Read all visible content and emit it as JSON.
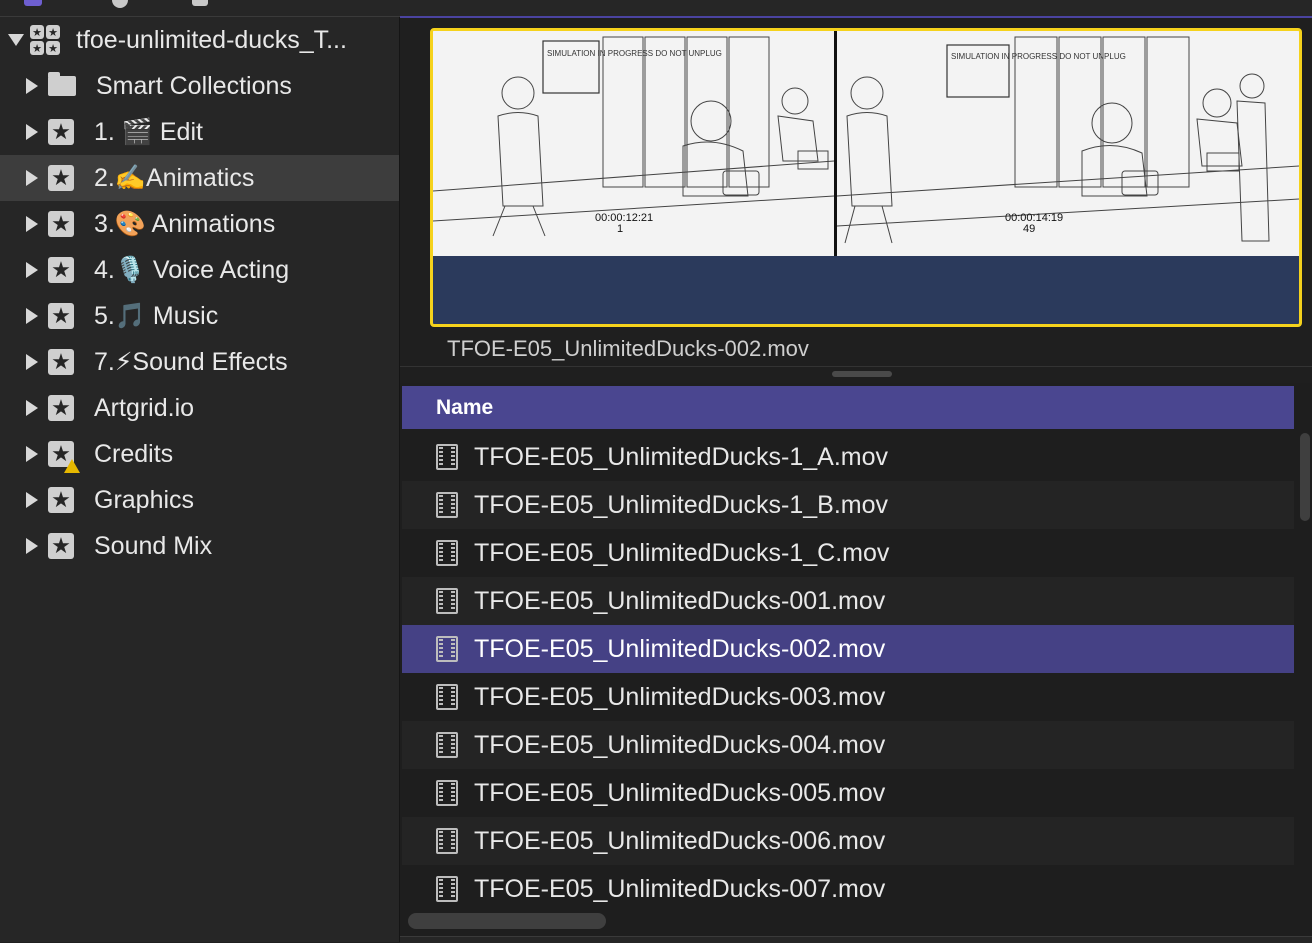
{
  "library": {
    "name": "tfoe-unlimited-ducks_T..."
  },
  "sidebar": {
    "items": [
      {
        "label": "Smart Collections",
        "icon": "folder-icon"
      },
      {
        "label": "1. 🎬 Edit",
        "icon": "star-icon"
      },
      {
        "label": "2.✍️Animatics",
        "icon": "star-icon",
        "selected": true
      },
      {
        "label": "3.🎨 Animations",
        "icon": "star-icon"
      },
      {
        "label": "4.🎙️ Voice Acting",
        "icon": "star-icon"
      },
      {
        "label": "5.🎵 Music",
        "icon": "star-icon"
      },
      {
        "label": "7.⚡Sound Effects",
        "icon": "star-icon"
      },
      {
        "label": "Artgrid.io",
        "icon": "star-icon"
      },
      {
        "label": "Credits",
        "icon": "star-warning-icon"
      },
      {
        "label": "Graphics",
        "icon": "star-icon"
      },
      {
        "label": "Sound Mix",
        "icon": "star-icon"
      }
    ]
  },
  "viewer": {
    "clip_name": "TFOE-E05_UnlimitedDucks-002.mov",
    "thumb1_sign": "SIMULATION IN PROGRESS DO NOT UNPLUG",
    "thumb1_timecode": "00:00:12:21",
    "thumb1_frame": "1",
    "thumb2_sign": "SIMULATION IN PROGRESS DO NOT UNPLUG",
    "thumb2_timecode": "00:00:14:19",
    "thumb2_frame": "49",
    "accent_color": "#f5d21c"
  },
  "browser": {
    "column_name": "Name",
    "rows": [
      "TFOE-E05_UnlimitedDucks-1_A.mov",
      "TFOE-E05_UnlimitedDucks-1_B.mov",
      "TFOE-E05_UnlimitedDucks-1_C.mov",
      "TFOE-E05_UnlimitedDucks-001.mov",
      "TFOE-E05_UnlimitedDucks-002.mov",
      "TFOE-E05_UnlimitedDucks-003.mov",
      "TFOE-E05_UnlimitedDucks-004.mov",
      "TFOE-E05_UnlimitedDucks-005.mov",
      "TFOE-E05_UnlimitedDucks-006.mov",
      "TFOE-E05_UnlimitedDucks-007.mov"
    ],
    "selected_index": 4,
    "selection_color": "#454185"
  }
}
